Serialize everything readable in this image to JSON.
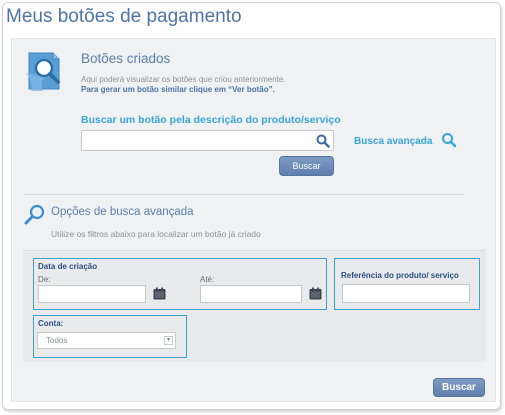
{
  "page": {
    "title": "Meus botões de pagamento"
  },
  "created": {
    "title": "Botões criados",
    "description": "Aqui poderá visualizar os botões que criou anteriormente.",
    "hint": "Para gerar um botão similar clique em “Ver botão”."
  },
  "search": {
    "label": "Buscar um botão pela descrição do produto/serviço",
    "value": "",
    "button": "Buscar",
    "advanced_link": "Busca avançada"
  },
  "advanced": {
    "title": "Opções de busca avançada",
    "description": "Utilize os filtros abaixo para localizar um botão já criado",
    "date_group": {
      "title": "Data de criação",
      "from_label": "De:",
      "to_label": "Até:",
      "from_value": "",
      "to_value": ""
    },
    "reference": {
      "title": "Referência do produto/ serviço",
      "value": ""
    },
    "account": {
      "title": "Conta:",
      "selected": "Todos"
    },
    "button": "Buscar"
  },
  "colors": {
    "title": "#4f74a6",
    "link": "#39a5d3",
    "button": "#6584b3",
    "filter_border": "#3aa1d2"
  },
  "icons": [
    "document-search-icon",
    "magnifier-icon",
    "calendar-icon",
    "chevron-down-icon"
  ]
}
